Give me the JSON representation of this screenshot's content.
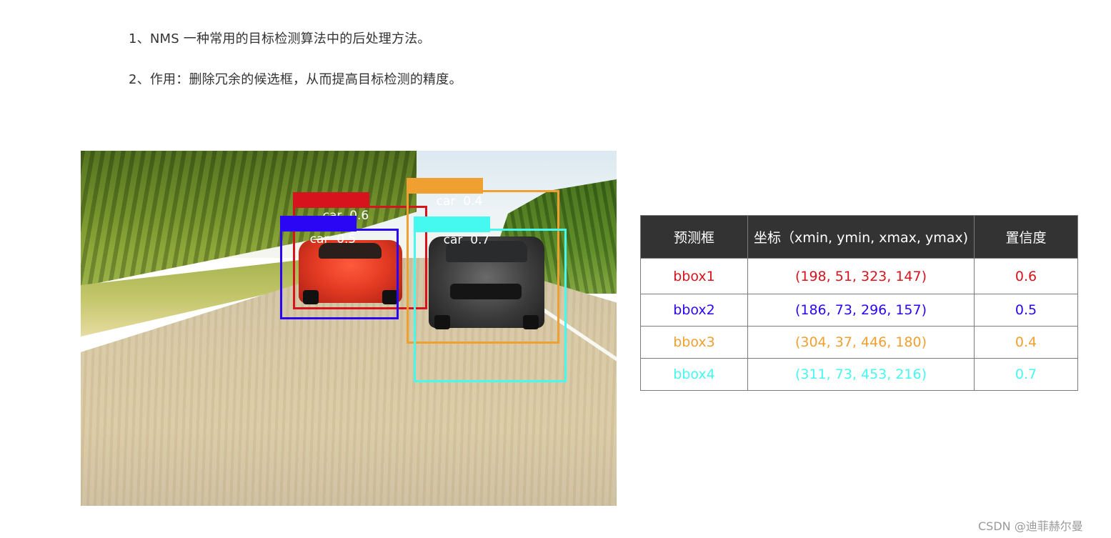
{
  "article": {
    "line1": "1、NMS 一种常用的目标检测算法中的后处理方法。",
    "line2": "2、作用：删除冗余的候选框，从而提高目标检测的精度。"
  },
  "figure": {
    "boxes": [
      {
        "label": "car",
        "score": "0.6",
        "color": "#d7141e"
      },
      {
        "label": "car",
        "score": "0.5",
        "color": "#2a06f5"
      },
      {
        "label": "car",
        "score": "0.4",
        "color": "#f0a030"
      },
      {
        "label": "car",
        "score": "0.7",
        "color": "#45f8f0"
      }
    ]
  },
  "table": {
    "headers": [
      "预测框",
      "坐标（xmin, ymin, xmax, ymax)",
      "置信度"
    ],
    "rows": [
      {
        "name": "bbox1",
        "coords": "(198, 51, 323, 147)",
        "score": "0.6",
        "color": "#d7141e"
      },
      {
        "name": "bbox2",
        "coords": "(186, 73, 296, 157)",
        "score": "0.5",
        "color": "#2a06f5"
      },
      {
        "name": "bbox3",
        "coords": "(304, 37, 446, 180)",
        "score": "0.4",
        "color": "#f0a030"
      },
      {
        "name": "bbox4",
        "coords": "(311, 73, 453, 216)",
        "score": "0.7",
        "color": "#45f8f0"
      }
    ]
  },
  "watermark": "CSDN @迪菲赫尔曼"
}
